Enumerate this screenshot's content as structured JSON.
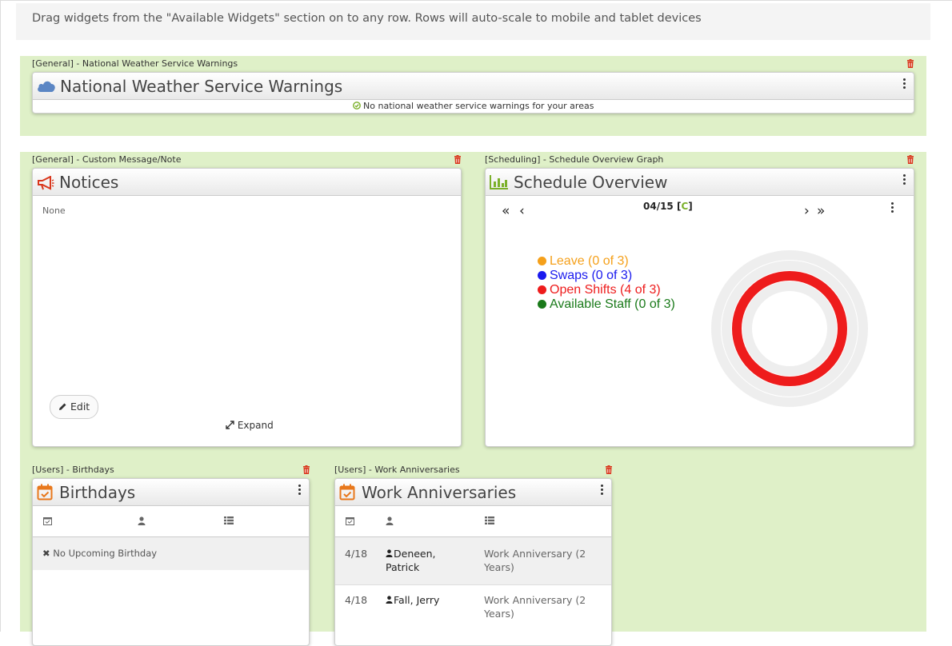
{
  "instructions": "Drag widgets from the \"Available Widgets\" section on to any row. Rows will auto-scale to mobile and tablet devices",
  "colors": {
    "row_bg": "#dff0c8",
    "leave": "#f5a01a",
    "swaps": "#1a1aee",
    "open_shifts": "#ee1c1c",
    "available_staff": "#1a7a1a",
    "accent_green": "#7bb02a",
    "icon_orange": "#e8781c",
    "trash_red": "#d9361c"
  },
  "nws": {
    "label": "[General] - National Weather Service Warnings",
    "title": "National Weather Service Warnings",
    "icon": "cloud-icon",
    "status": "No national weather service warnings for your areas"
  },
  "notices": {
    "label": "[General] - Custom Message/Note",
    "title": "Notices",
    "icon": "bullhorn-icon",
    "body": "None",
    "edit_label": "Edit",
    "expand_label": "Expand"
  },
  "schedule": {
    "label": "[Scheduling] - Schedule Overview Graph",
    "title": "Schedule Overview",
    "icon": "bar-chart-icon",
    "date": "04/15",
    "date_open": "[",
    "date_code": "C",
    "date_close": "]",
    "legend": [
      {
        "label": "Leave (0 of 3)",
        "color": "#f5a01a"
      },
      {
        "label": "Swaps (0 of 3)",
        "color": "#1a1aee"
      },
      {
        "label": "Open Shifts (4 of 3)",
        "color": "#ee1c1c"
      },
      {
        "label": "Available Staff (0 of 3)",
        "color": "#1a7a1a"
      }
    ]
  },
  "chart_data": {
    "type": "radial-bar",
    "series": [
      {
        "name": "Leave",
        "value": 0,
        "max": 3
      },
      {
        "name": "Swaps",
        "value": 0,
        "max": 3
      },
      {
        "name": "Open Shifts",
        "value": 4,
        "max": 3
      },
      {
        "name": "Available Staff",
        "value": 0,
        "max": 3
      }
    ]
  },
  "birthdays": {
    "label": "[Users] - Birthdays",
    "title": "Birthdays",
    "icon": "calendar-check-icon",
    "empty": "No Upcoming Birthday"
  },
  "anniversaries": {
    "label": "[Users] - Work Anniversaries",
    "title": "Work Anniversaries",
    "icon": "calendar-check-icon",
    "rows": [
      {
        "date": "4/18",
        "name_line1": "Deneen,",
        "name_line2": "Patrick",
        "event_line1": "Work Anniversary (2",
        "event_line2": "Years)"
      },
      {
        "date": "4/18",
        "name_line1": "Fall, Jerry",
        "name_line2": "",
        "event_line1": "Work Anniversary (2",
        "event_line2": "Years)"
      }
    ]
  }
}
